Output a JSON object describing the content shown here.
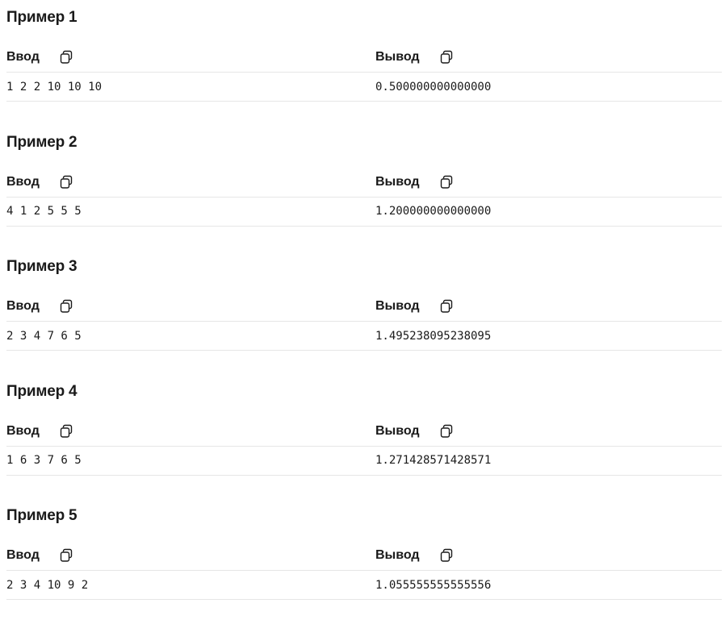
{
  "examples": [
    {
      "title": "Пример 1",
      "input_label": "Ввод",
      "output_label": "Вывод",
      "input_value": "1 2 2 10 10 10",
      "output_value": "0.500000000000000",
      "copy_icon": "copy-icon"
    },
    {
      "title": "Пример 2",
      "input_label": "Ввод",
      "output_label": "Вывод",
      "input_value": "4 1 2 5 5 5",
      "output_value": "1.200000000000000",
      "copy_icon": "copy-icon"
    },
    {
      "title": "Пример 3",
      "input_label": "Ввод",
      "output_label": "Вывод",
      "input_value": "2 3 4 7 6 5",
      "output_value": "1.495238095238095",
      "copy_icon": "copy-icon"
    },
    {
      "title": "Пример 4",
      "input_label": "Ввод",
      "output_label": "Вывод",
      "input_value": "1 6 3 7 6 5",
      "output_value": "1.271428571428571",
      "copy_icon": "copy-icon"
    },
    {
      "title": "Пример 5",
      "input_label": "Ввод",
      "output_label": "Вывод",
      "input_value": "2 3 4 10 9 2",
      "output_value": "1.055555555555556",
      "copy_icon": "copy-icon"
    }
  ],
  "colors": {
    "text": "#1a1a1a",
    "divider": "#e6e6e6",
    "icon": "#1a1a1a"
  }
}
